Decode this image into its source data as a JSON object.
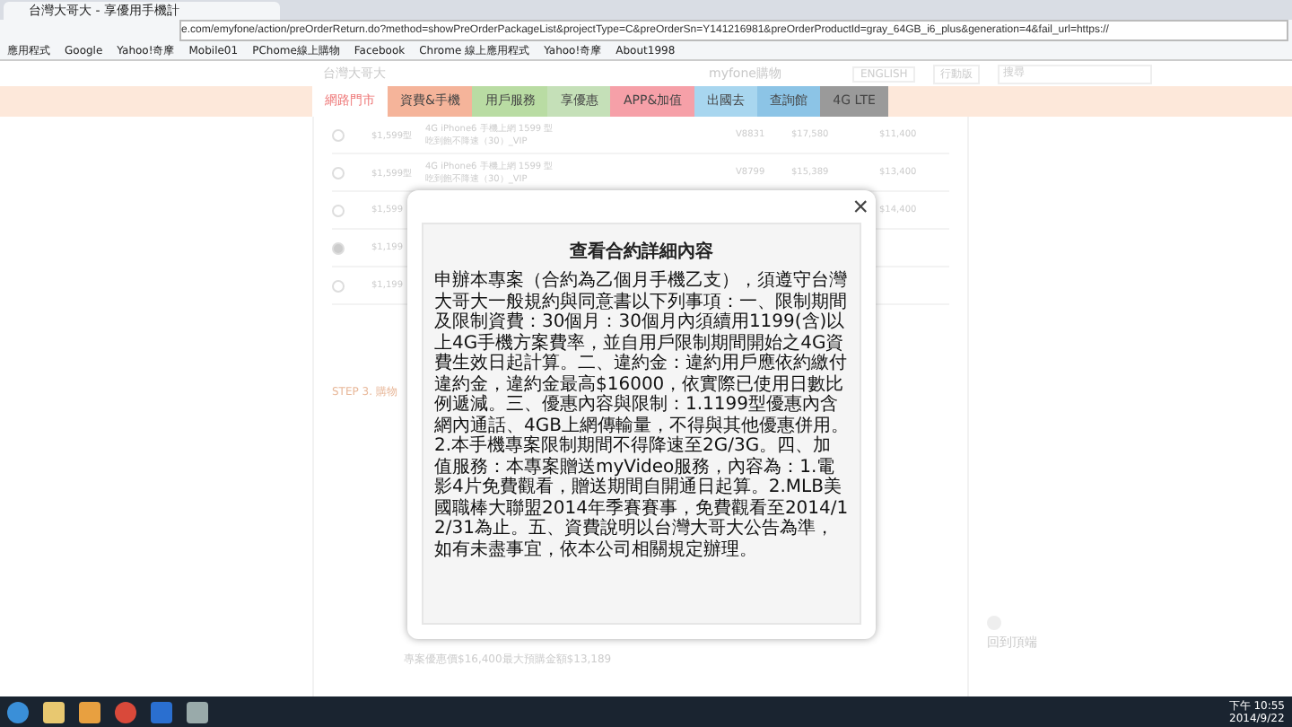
{
  "browser": {
    "tab_title": "台灣大哥大 - 享優用手機計",
    "url": "e.com/emyfone/action/preOrderReturn.do?method=showPreOrderPackageList&projectType=C&preOrderSn=Y141216981&preOrderProductId=gray_64GB_i6_plus&generation=4&fail_url=https://",
    "bookmarks": [
      "應用程式",
      "Google",
      "Yahoo!奇摩",
      "Mobile01",
      "PChome線上購物",
      "Facebook",
      "Chrome 線上應用程式",
      "Yahoo!奇摩",
      "About1998"
    ]
  },
  "site": {
    "logo": "台灣大哥大",
    "shop_link": "myfone購物",
    "english": "ENGLISH",
    "mobile": "行動版",
    "search": {
      "placeholder": "搜尋"
    },
    "nav": [
      {
        "label": "網路門市",
        "selected": true,
        "color": "#ffffff"
      },
      {
        "label": "資費&手機",
        "selected": false,
        "color": "#f5b49a"
      },
      {
        "label": "用戶服務",
        "selected": false,
        "color": "#b9dca3"
      },
      {
        "label": "享優惠",
        "selected": false,
        "color": "#c5e0b8"
      },
      {
        "label": "APP&加值",
        "selected": false,
        "color": "#f6a0a8"
      },
      {
        "label": "出國去",
        "selected": false,
        "color": "#a8d6ef"
      },
      {
        "label": "查詢館",
        "selected": false,
        "color": "#8cc4e6"
      },
      {
        "label": "4G LTE",
        "selected": false,
        "color": "#9a9a9a"
      }
    ]
  },
  "plans": [
    {
      "selected": false,
      "rate": "$1,599型",
      "name": "4G iPhone6 手機上網 1599 型",
      "note": "吃到飽不降速（30）_VIP",
      "code": "V8831",
      "price": "$17,580",
      "prepay": "$11,400"
    },
    {
      "selected": false,
      "rate": "$1,599型",
      "name": "4G iPhone6 手機上網 1599 型",
      "note": "吃到飽不降速（30）_VIP",
      "code": "V8799",
      "price": "$15,389",
      "prepay": "$13,400"
    },
    {
      "selected": false,
      "rate": "$1,599",
      "prepay": "$14,400"
    },
    {
      "selected": true,
      "rate": "$1,199"
    },
    {
      "selected": false,
      "rate": "$1,199"
    }
  ],
  "step3": "STEP 3. 購物",
  "summary": "專案優惠價$16,400最大預購金額$13,189",
  "back_to_top": "回到頂端",
  "modal": {
    "title": "查看合約詳細內容",
    "body": "申辦本專案（合約為乙個月手機乙支），須遵守台灣大哥大一般規約與同意書以下列事項：一、限制期間及限制資費：30個月：30個月內須續用1199(含)以上4G手機方案費率，並自用戶限制期間開始之4G資費生效日起計算。二、違約金：違約用戶應依約繳付違約金，違約金最高$16000，依實際已使用日數比例遞減。三、優惠內容與限制：1.1199型優惠內含網內通話、4GB上網傳輸量，不得與其他優惠併用。2.本手機專案限制期間不得降速至2G/3G。四、加值服務：本專案贈送myVideo服務，內容為：1.電影4片免費觀看，贈送期間自開通日起算。2.MLB美國職棒大聯盟2014年季賽賽事，免費觀看至2014/12/31為止。五、資費說明以台灣大哥大公告為準，如有未盡事宜，依本公司相關規定辦理。",
    "close": "×"
  },
  "taskbar": {
    "time": "下午 10:55",
    "date": "2014/9/22"
  }
}
